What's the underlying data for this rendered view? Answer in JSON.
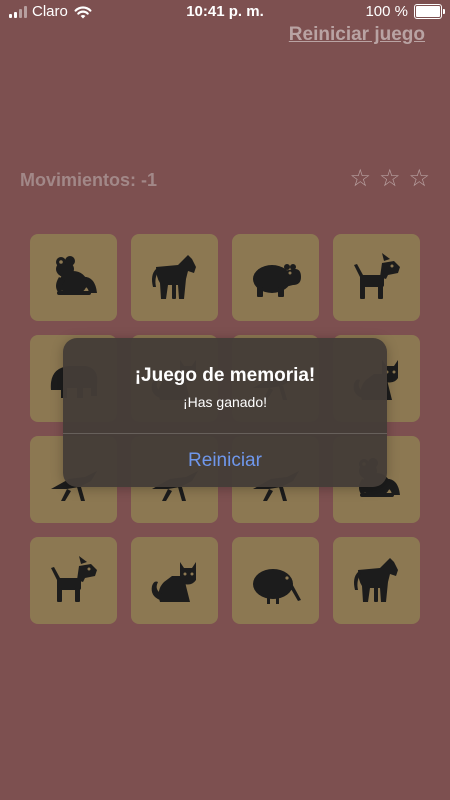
{
  "status_bar": {
    "carrier": "Claro",
    "time": "10:41 p. m.",
    "battery": "100 %",
    "signal_level": 2,
    "battery_level": 1.0
  },
  "header": {
    "restart_link": "Reiniciar juego"
  },
  "game": {
    "moves_label": "Movimientos: -1",
    "stars": [
      "☆",
      "☆",
      "☆"
    ],
    "cards": [
      "frog-icon",
      "horse-icon",
      "hippo-icon",
      "dog-icon",
      "elephant-icon",
      "cat-icon",
      "bird-icon",
      "cat-icon",
      "bird-icon",
      "bird-icon",
      "bird-icon",
      "frog-icon",
      "dog-icon",
      "cat-icon",
      "kiwi-icon",
      "horse-icon"
    ]
  },
  "dialog": {
    "title": "¡Juego de memoria!",
    "message": "¡Has ganado!",
    "button": "Reiniciar"
  },
  "colors": {
    "background": "#7d5050",
    "card": "#8c7852",
    "icon": "#1c1c1c",
    "dialog": "#443c37",
    "dialog_button": "#6f97ec"
  }
}
